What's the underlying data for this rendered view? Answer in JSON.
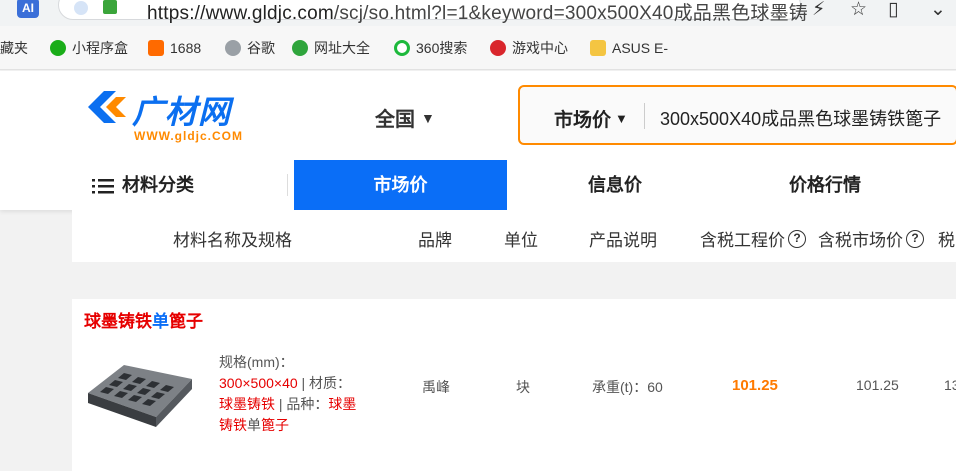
{
  "browser": {
    "url_prefix": "https://www.gldjc.com",
    "url_rest": "/scj/so.html?l=1&keyword=300x500X40成品黑色球墨铸",
    "ai_label": "AI"
  },
  "bookmarks": [
    {
      "label": "收藏夹",
      "icon": "folder-icon"
    },
    {
      "label": "小程序盒",
      "icon": "miniprogram-icon"
    },
    {
      "label": "1688",
      "icon": "alibaba-icon"
    },
    {
      "label": "谷歌",
      "icon": "globe-icon"
    },
    {
      "label": "网址大全",
      "icon": "plus-circle-icon"
    },
    {
      "label": "360搜索",
      "icon": "search-360-icon"
    },
    {
      "label": "游戏中心",
      "icon": "game-icon"
    },
    {
      "label": "ASUS E-",
      "icon": "folder-icon"
    }
  ],
  "site": {
    "logo_text": "广材网",
    "logo_url": "WWW.gldjc.COM",
    "region": "全国",
    "search_type": "市场价",
    "search_value": "300x500X40成品黑色球墨铸铁篦子",
    "nav": {
      "category": "材料分类",
      "market": "市场价",
      "info": "信息价",
      "trend": "价格行情"
    }
  },
  "table": {
    "headers": {
      "name": "材料名称及规格",
      "brand": "品牌",
      "unit": "单位",
      "desc": "产品说明",
      "eng_price": "含税工程价",
      "mkt_price": "含税市场价",
      "more": "税"
    },
    "help_glyph": "?"
  },
  "result": {
    "title_a": "球墨铸铁",
    "title_b": "单",
    "title_c": "篦子",
    "spec_label": "规格(mm)：",
    "spec_size": "300×500×40",
    "spec_material_label": " | 材质：",
    "spec_material": "球墨铸铁",
    "spec_kind_label": " | 品种：",
    "spec_kind_a": "球墨",
    "spec_kind_b": "铸铁",
    "spec_kind_c": "单",
    "spec_kind_d": "篦子",
    "brand": "禹峰",
    "unit": "块",
    "desc": "承重(t)：60",
    "eng_price": "101.25",
    "mkt_price": "101.25",
    "more": "13"
  }
}
